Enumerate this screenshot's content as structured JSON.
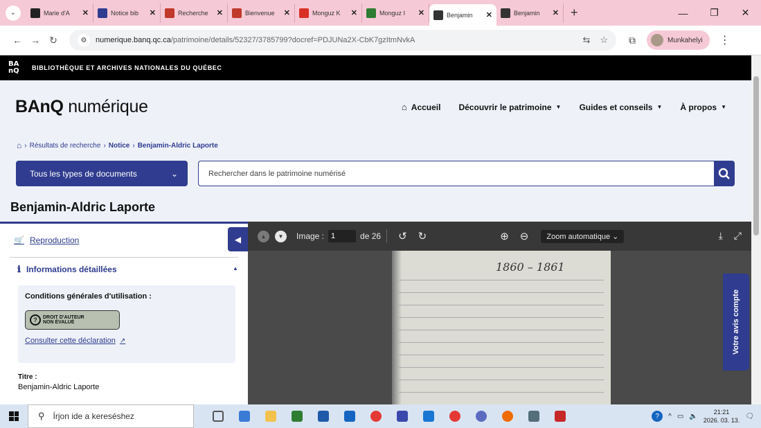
{
  "browser": {
    "tabs": [
      {
        "label": "Marie d'A",
        "color": "#222"
      },
      {
        "label": "Notice bib",
        "color": "#2f3c8f"
      },
      {
        "label": "Recherche",
        "color": "#c0392b"
      },
      {
        "label": "Bienvenue",
        "color": "#c0392b"
      },
      {
        "label": "Monguz K",
        "color": "#d93025"
      },
      {
        "label": "Monguz I",
        "color": "#2e7d32"
      },
      {
        "label": "Benjamin",
        "color": "#333"
      },
      {
        "label": "Benjamin",
        "color": "#333"
      }
    ],
    "active_tab_index": 6,
    "url_host": "numerique.banq.qc.ca",
    "url_path": "/patrimoine/details/52327/3785799?docref=PDJUNa2X-CbK7gzItmNvkA",
    "profile_name": "Munkahelyi"
  },
  "banq": {
    "logo": "BA\nnQ",
    "institution": "BIBLIOTHÈQUE ET ARCHIVES NATIONALES DU QUÉBEC"
  },
  "header": {
    "brand_bold": "BAnQ",
    "brand_rest": " numérique",
    "nav": {
      "home": "Accueil",
      "discover": "Découvrir le patrimoine",
      "guides": "Guides et conseils",
      "about": "À propos"
    }
  },
  "breadcrumb": {
    "results": "Résultats de recherche",
    "notice": "Notice",
    "current": "Benjamin-Aldric Laporte"
  },
  "search": {
    "doc_type": "Tous les types de documents",
    "placeholder": "Rechercher dans le patrimoine numérisé"
  },
  "page_title": "Benjamin-Aldric Laporte",
  "sidebar": {
    "reproduction": "Reproduction",
    "info_heading": "Informations détaillées",
    "conditions_title": "Conditions générales d'utilisation :",
    "copyright_line1": "DROIT D'AUTEUR",
    "copyright_line2": "NON ÉVALUÉ",
    "declaration_link": "Consulter cette déclaration",
    "title_label": "Titre :",
    "title_value": "Benjamin-Aldric Laporte"
  },
  "viewer": {
    "image_label": "Image :",
    "image_current": "1",
    "image_total": "de 26",
    "zoom": "Zoom automatique",
    "scan_year": "1860 – 1861"
  },
  "feedback_tab": "Votre avis compte",
  "taskbar": {
    "search_placeholder": "Írjon ide a kereséshez",
    "time": "21:21",
    "date": "2026. 03. 13."
  }
}
